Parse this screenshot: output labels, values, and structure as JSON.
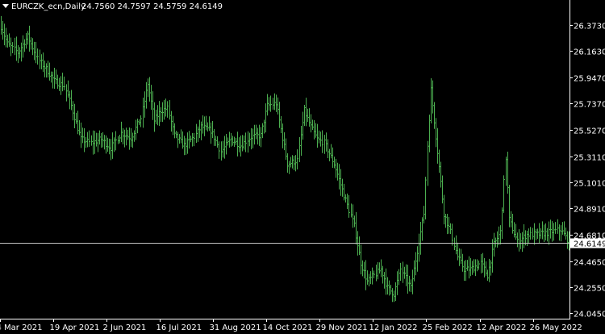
{
  "header": {
    "symbol": "EURCZK_ecn,Daily",
    "ohlc": "24.7560 24.7597 24.5759 24.6149"
  },
  "colors": {
    "background": "#000000",
    "bars": "#4caf50",
    "axis": "#ffffff",
    "current_line": "#c0c0c0"
  },
  "chart_data": {
    "type": "bar",
    "style": "ohlc-bars",
    "symbol": "EURCZK_ecn",
    "timeframe": "Daily",
    "current_price": "24.6149",
    "current_value": 24.6149,
    "ylim": [
      24.02,
      26.47
    ],
    "y_ticks": [
      "26.3730",
      "26.1630",
      "25.9470",
      "25.7370",
      "25.5270",
      "25.3110",
      "25.1010",
      "24.8910",
      "24.6810",
      "24.4650",
      "24.2550",
      "24.0450"
    ],
    "y_tick_values": [
      26.373,
      26.163,
      25.947,
      25.737,
      25.527,
      25.311,
      25.101,
      24.891,
      24.681,
      24.465,
      24.255,
      24.045
    ],
    "x_ticks": [
      "4 Mar 2021",
      "19 Apr 2021",
      "2 Jun 2021",
      "16 Jul 2021",
      "31 Aug 2021",
      "14 Oct 2021",
      "29 Nov 2021",
      "12 Jan 2022",
      "25 Feb 2022",
      "12 Apr 2022",
      "26 May 2022"
    ],
    "x_tick_positions": [
      0,
      32,
      64,
      96,
      128,
      160,
      192,
      224,
      256,
      288,
      320
    ],
    "bar_count": 342,
    "close_keypoints": [
      [
        0,
        26.36
      ],
      [
        4,
        26.22
      ],
      [
        10,
        26.15
      ],
      [
        16,
        26.28
      ],
      [
        22,
        26.1
      ],
      [
        28,
        26.0
      ],
      [
        32,
        25.92
      ],
      [
        38,
        25.88
      ],
      [
        42,
        25.72
      ],
      [
        48,
        25.45
      ],
      [
        54,
        25.42
      ],
      [
        60,
        25.45
      ],
      [
        66,
        25.38
      ],
      [
        72,
        25.5
      ],
      [
        78,
        25.46
      ],
      [
        84,
        25.62
      ],
      [
        88,
        25.9
      ],
      [
        92,
        25.6
      ],
      [
        96,
        25.68
      ],
      [
        100,
        25.7
      ],
      [
        104,
        25.48
      ],
      [
        110,
        25.4
      ],
      [
        116,
        25.47
      ],
      [
        120,
        25.55
      ],
      [
        126,
        25.52
      ],
      [
        132,
        25.35
      ],
      [
        138,
        25.45
      ],
      [
        144,
        25.4
      ],
      [
        150,
        25.47
      ],
      [
        156,
        25.48
      ],
      [
        160,
        25.72
      ],
      [
        165,
        25.74
      ],
      [
        172,
        25.25
      ],
      [
        178,
        25.28
      ],
      [
        182,
        25.68
      ],
      [
        186,
        25.55
      ],
      [
        190,
        25.45
      ],
      [
        194,
        25.42
      ],
      [
        200,
        25.25
      ],
      [
        206,
        25.0
      ],
      [
        212,
        24.75
      ],
      [
        216,
        24.45
      ],
      [
        220,
        24.3
      ],
      [
        224,
        24.35
      ],
      [
        228,
        24.4
      ],
      [
        232,
        24.25
      ],
      [
        236,
        24.2
      ],
      [
        240,
        24.4
      ],
      [
        246,
        24.25
      ],
      [
        250,
        24.55
      ],
      [
        254,
        24.85
      ],
      [
        256,
        25.4
      ],
      [
        258,
        25.85
      ],
      [
        262,
        25.35
      ],
      [
        266,
        24.85
      ],
      [
        270,
        24.7
      ],
      [
        274,
        24.5
      ],
      [
        278,
        24.4
      ],
      [
        282,
        24.4
      ],
      [
        288,
        24.45
      ],
      [
        292,
        24.35
      ],
      [
        296,
        24.6
      ],
      [
        300,
        24.7
      ],
      [
        303,
        25.3
      ],
      [
        305,
        24.8
      ],
      [
        310,
        24.62
      ],
      [
        316,
        24.68
      ],
      [
        322,
        24.68
      ],
      [
        330,
        24.7
      ],
      [
        336,
        24.72
      ],
      [
        341,
        24.62
      ]
    ]
  }
}
